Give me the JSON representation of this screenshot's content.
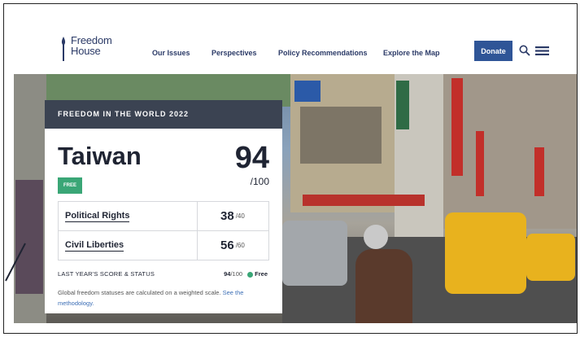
{
  "brand": {
    "line1": "Freedom",
    "line2": "House"
  },
  "nav": [
    {
      "label": "Our Issues"
    },
    {
      "label": "Perspectives"
    },
    {
      "label": "Policy Recommendations"
    },
    {
      "label": "Explore the Map"
    }
  ],
  "donate_label": "Donate",
  "icons": {
    "search": "search-icon",
    "menu": "menu-icon"
  },
  "colors": {
    "donate": "#2f5597",
    "card_header": "#3b4352",
    "free": "#3aa676",
    "link": "#3d6fb6"
  },
  "card": {
    "header": "FREEDOM IN THE WORLD 2022",
    "country": "Taiwan",
    "total_score": "94",
    "total_max": "/100",
    "status_badge": "FREE",
    "rows": [
      {
        "label": "Political Rights",
        "score": "38",
        "max": "/40"
      },
      {
        "label": "Civil Liberties",
        "score": "56",
        "max": "/60"
      }
    ],
    "last_year_label": "LAST YEAR'S SCORE & STATUS",
    "last_year_score": "94",
    "last_year_max": "/100",
    "last_year_status": "Free",
    "note_text": "Global freedom statuses are calculated on a weighted scale. ",
    "note_link": "See the methodology."
  }
}
